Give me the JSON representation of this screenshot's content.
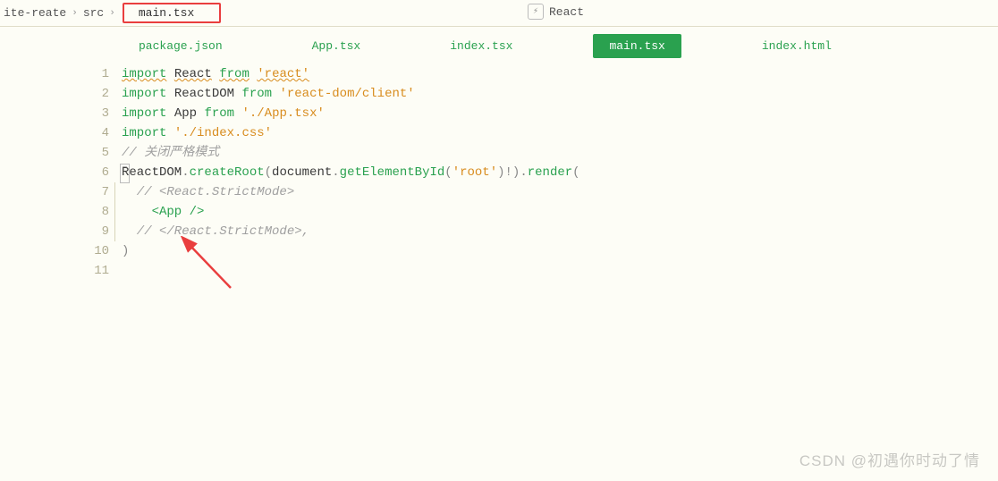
{
  "breadcrumb": {
    "root": "ite-reate",
    "folder": "src",
    "file": "main.tsx"
  },
  "helper": {
    "label": "React"
  },
  "tabs": [
    {
      "label": "package.json",
      "active": false
    },
    {
      "label": "App.tsx",
      "active": false
    },
    {
      "label": "index.tsx",
      "active": false
    },
    {
      "label": "main.tsx",
      "active": true
    },
    {
      "label": "index.html",
      "active": false
    }
  ],
  "lines": {
    "n1": "1",
    "n2": "2",
    "n3": "3",
    "n4": "4",
    "n5": "5",
    "n6": "6",
    "n7": "7",
    "n8": "8",
    "n9": "9",
    "n10": "10",
    "n11": "11"
  },
  "code": {
    "l1_kw": "import",
    "l1_id": "React",
    "l1_from": "from",
    "l1_str": "'react'",
    "l2_kw": "import",
    "l2_id": "ReactDOM",
    "l2_from": "from",
    "l2_str": "'react-dom/client'",
    "l3_kw": "import",
    "l3_id": "App",
    "l3_from": "from",
    "l3_str": "'./App.tsx'",
    "l4_kw": "import",
    "l4_str": "'./index.css'",
    "l5_cmt": "// 关闭严格模式",
    "l6_a": "ReactDOM",
    "l6_b": "createRoot",
    "l6_c": "document",
    "l6_d": "getElementById",
    "l6_e": "'root'",
    "l6_f": "render",
    "l7_cmt": "  // <React.StrictMode>",
    "l8_tag": "    <App />",
    "l9_cmt": "  // </React.StrictMode>,",
    "l10": ")"
  },
  "watermark": "CSDN @初遇你时动了情"
}
